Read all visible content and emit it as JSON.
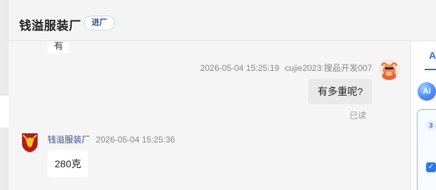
{
  "header": {
    "title": "钱溢服装厂",
    "badge": "进厂"
  },
  "messages": [
    {
      "side": "left",
      "partial": true,
      "text": "有"
    },
    {
      "side": "right",
      "time": "2026-05-04 15:25:19",
      "sender": "cujie2023:搜品开发007",
      "text": "有多重呢?",
      "status": "已读",
      "avatar_icon": "bull-avatar-icon"
    },
    {
      "side": "left",
      "sender": "钱溢服装厂",
      "time": "2026-05-04 15:25:36",
      "text": "280克",
      "avatar_icon": "shield-logo-icon"
    }
  ],
  "right_panel": {
    "tab_label": "A",
    "ai_label": "Ai",
    "card_number": "3",
    "checkbox_checked": true,
    "accent_color": "#2c6fe0"
  }
}
